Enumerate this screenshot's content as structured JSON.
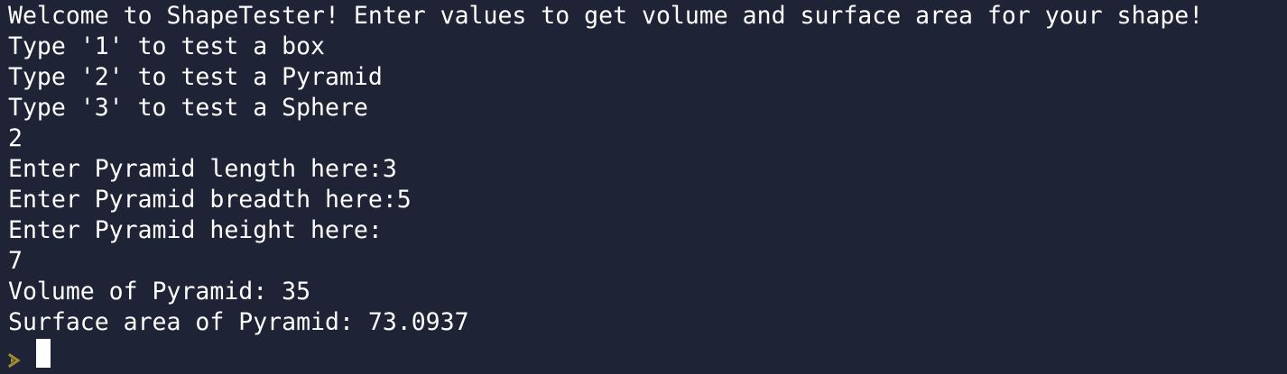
{
  "terminal": {
    "lines": [
      "Welcome to ShapeTester! Enter values to get volume and surface area for your shape!",
      "Type '1' to test a box",
      "Type '2' to test a Pyramid",
      "Type '3' to test a Sphere",
      "2",
      "Enter Pyramid length here:3",
      "Enter Pyramid breadth here:5",
      "Enter Pyramid height here:",
      "7",
      "Volume of Pyramid: 35",
      "Surface area of Pyramid: 73.0937"
    ],
    "prompt_icon": "chevron-right-icon",
    "colors": {
      "background": "#1e2335",
      "text": "#ffffff",
      "prompt": "#a08a2e",
      "cursor": "#ffffff"
    }
  }
}
